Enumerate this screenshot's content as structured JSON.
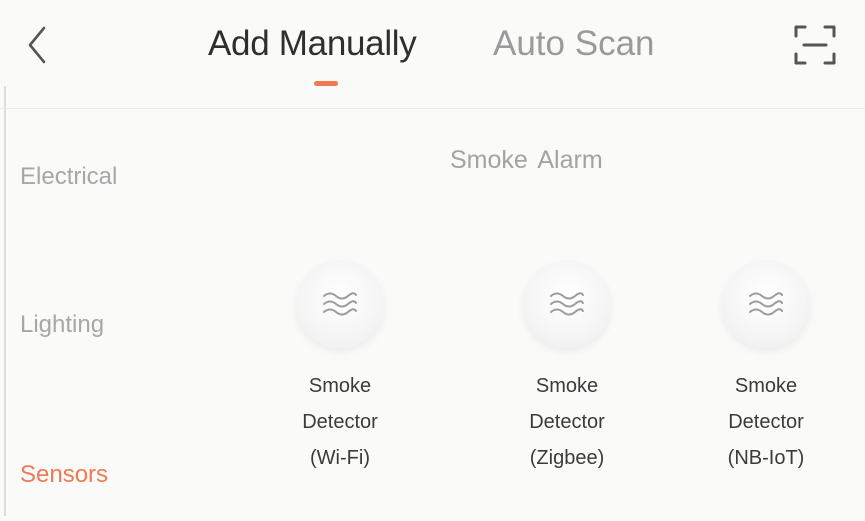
{
  "header": {
    "back_icon": "chevron-left-icon",
    "tabs": [
      {
        "label": "Add Manually",
        "active": true
      },
      {
        "label": "Auto Scan",
        "active": false
      }
    ],
    "scan_icon": "scan-frame-icon",
    "accent_color": "#f07a54"
  },
  "sidebar": {
    "items": [
      {
        "label": "Electrical",
        "active": false
      },
      {
        "label": "Lighting",
        "active": false
      },
      {
        "label": "Sensors",
        "active": true
      }
    ]
  },
  "main": {
    "section_title": "Smoke  Alarm",
    "devices": [
      {
        "line1": "Smoke",
        "line2": "Detector",
        "line3": "(Wi-Fi)",
        "icon": "smoke-waves-icon"
      },
      {
        "line1": "Smoke",
        "line2": "Detector",
        "line3": "(Zigbee)",
        "icon": "smoke-waves-icon"
      },
      {
        "line1": "Smoke",
        "line2": "Detector",
        "line3": "(NB-IoT)",
        "icon": "smoke-waves-icon"
      }
    ]
  }
}
